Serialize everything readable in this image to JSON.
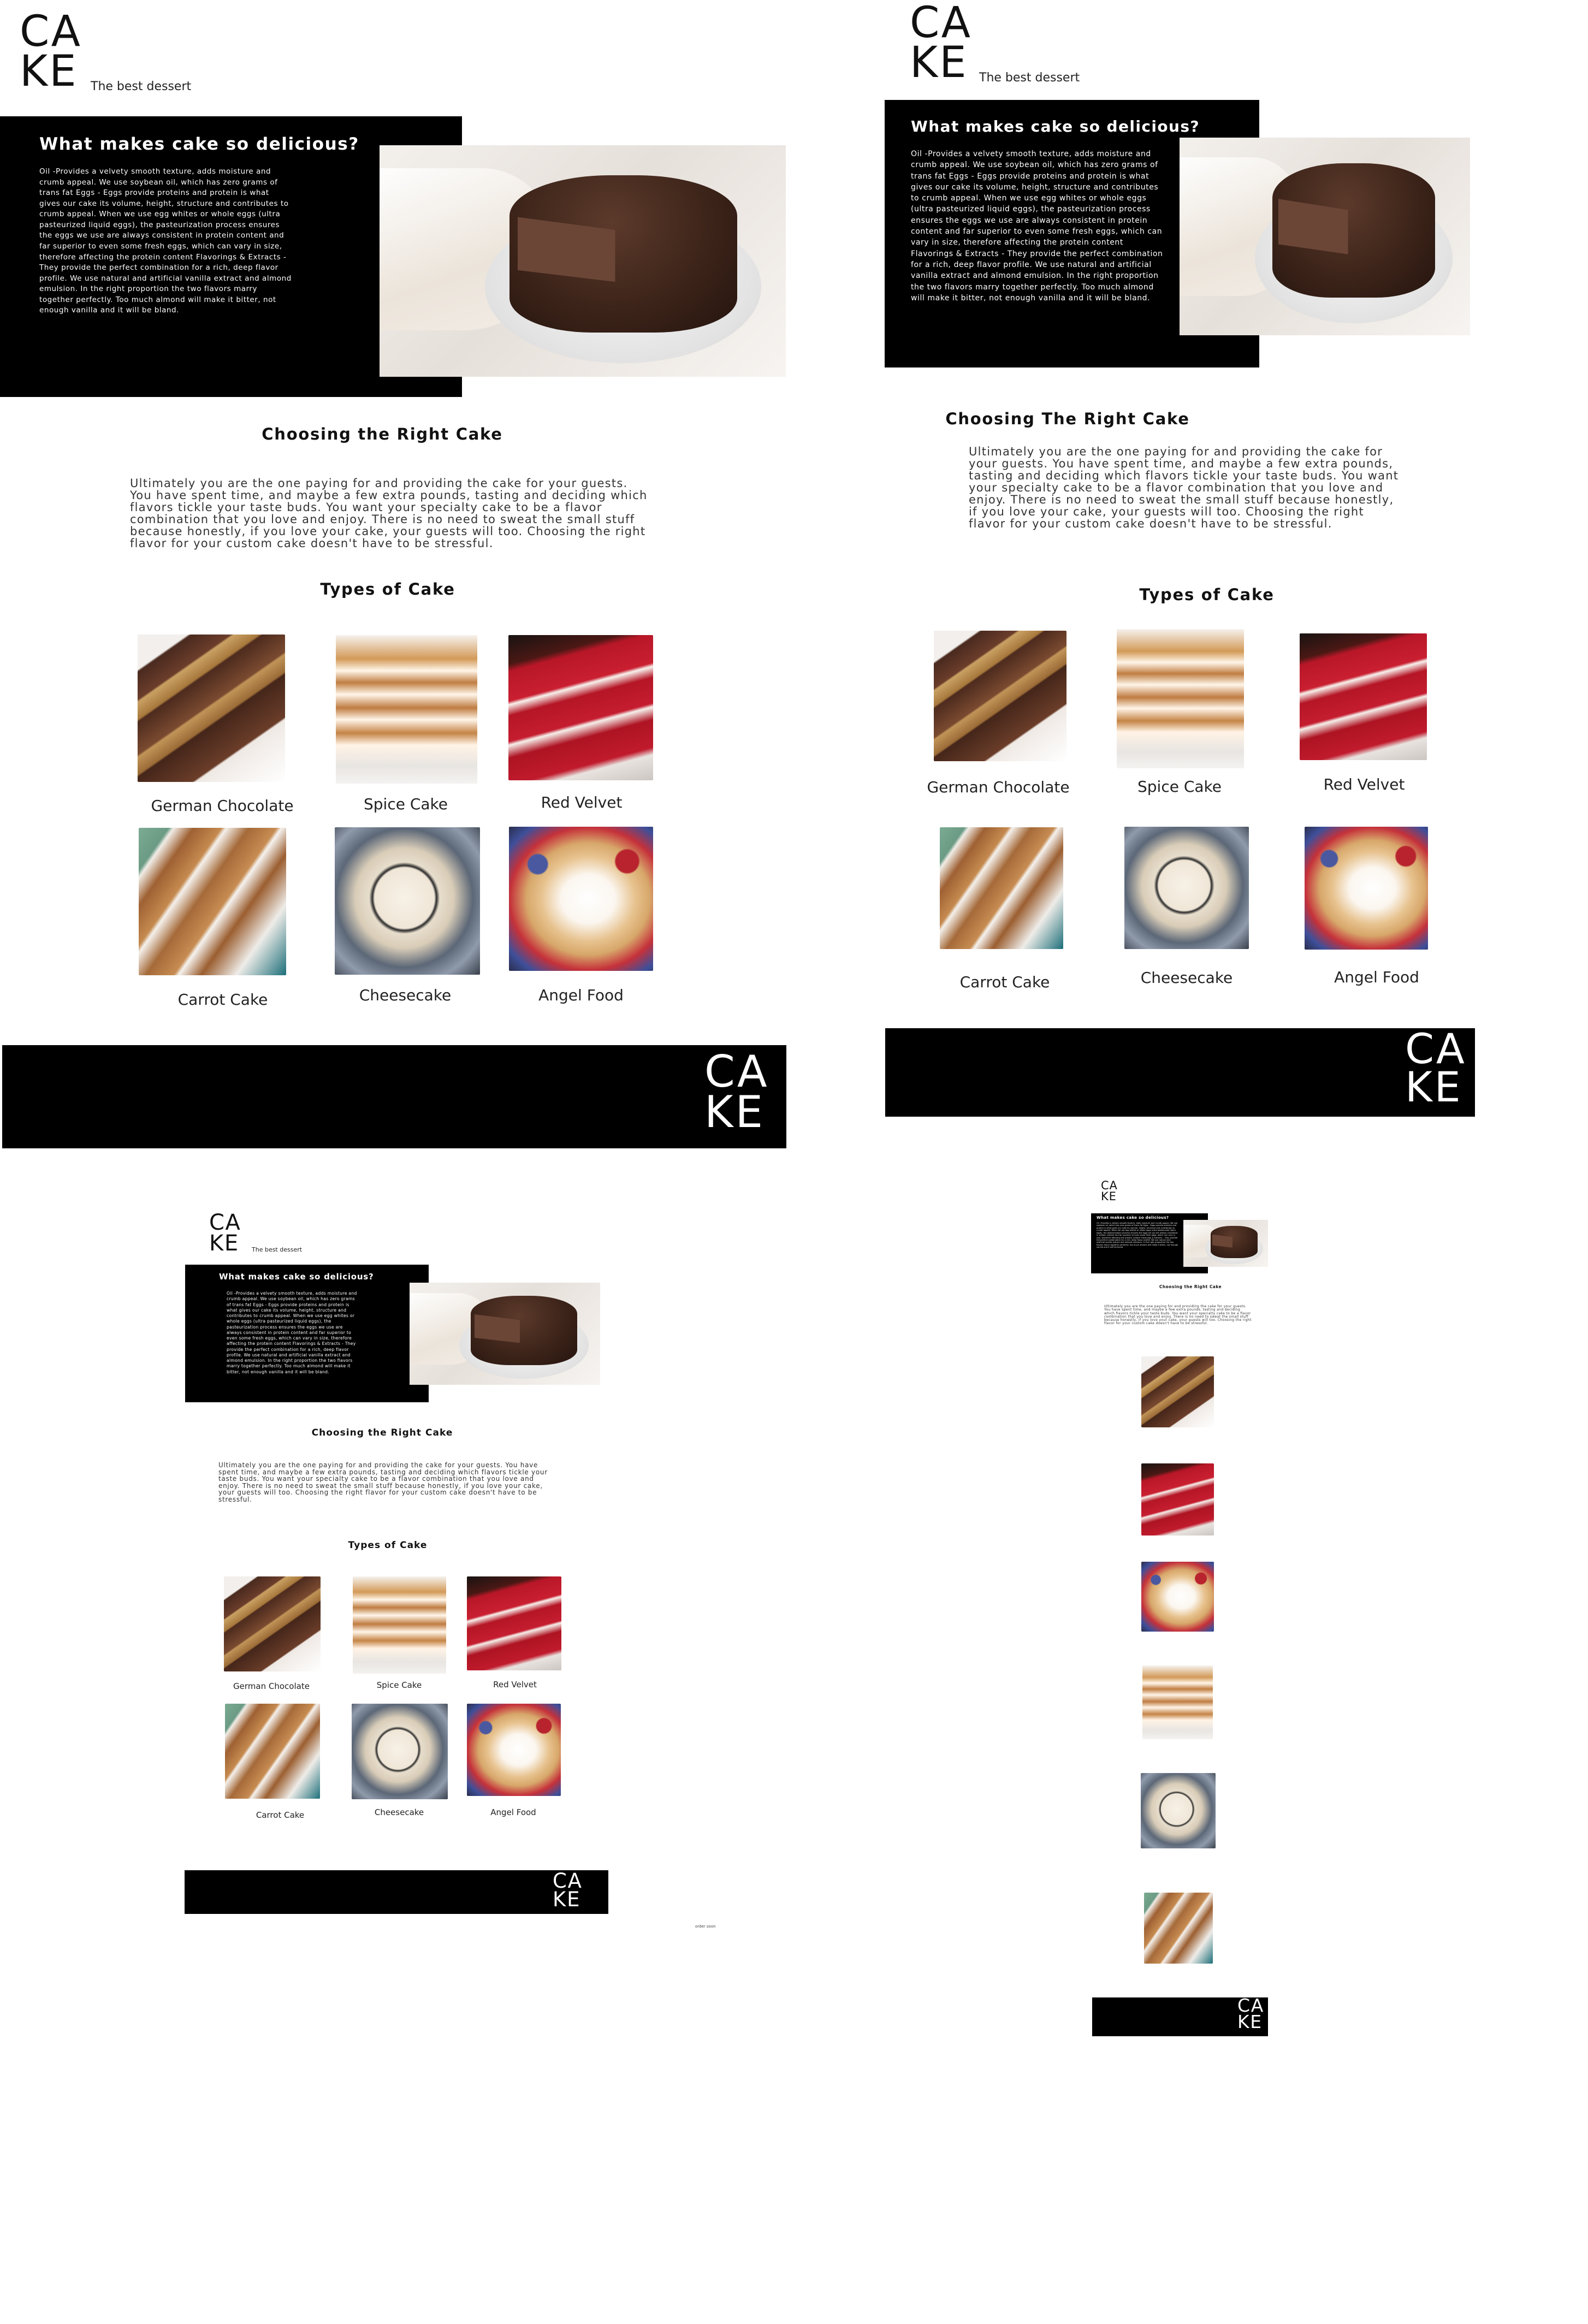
{
  "site": {
    "logo_top": "CA",
    "logo_bottom": "KE",
    "tagline": "The best dessert"
  },
  "hero": {
    "title": "What makes cake so delicious?",
    "body": "Oil -Provides a velvety smooth texture, adds moisture and crumb appeal. We use soybean oil, which has zero grams of trans fat Eggs - Eggs provide proteins and protein is what gives our cake its volume, height, structure and contributes to crumb appeal. When we use egg whites or whole eggs (ultra pasteurized liquid eggs), the pasteurization process ensures the eggs we use are always consistent in protein content and far superior to even some fresh eggs, which can vary in size, therefore affecting the protein content Flavorings & Extracts - They provide the perfect combination for a rich, deep flavor profile. We use natural and artificial vanilla extract and almond emulsion. In the right proportion the two flavors marry together perfectly. Too much almond will make it bitter, not enough vanilla and it will be bland."
  },
  "choosing": {
    "title": "Choosing the Right Cake",
    "title_alt": "Choosing The Right Cake",
    "body": "Ultimately you are the one paying for and providing the cake for your guests. You have spent time, and maybe a few extra pounds, tasting and deciding which flavors tickle your taste buds. You want your specialty cake to be a flavor combination that you love and enjoy. There is no need to sweat the small stuff because honestly, if you love your cake, your guests will too. Choosing the right flavor for your custom cake doesn't have to be stressful."
  },
  "types": {
    "title": "Types of Cake",
    "items": [
      {
        "label": "German Chocolate",
        "image": "german-chocolate-cake-photo"
      },
      {
        "label": "Spice Cake",
        "image": "spice-cake-photo"
      },
      {
        "label": "Red Velvet",
        "image": "red-velvet-cake-photo"
      },
      {
        "label": "Carrot Cake",
        "image": "carrot-cake-photo"
      },
      {
        "label": "Cheesecake",
        "image": "cheesecake-photo"
      },
      {
        "label": "Angel Food",
        "image": "angel-food-cake-photo"
      }
    ]
  },
  "footer": {
    "logo_top": "CA",
    "logo_bottom": "KE"
  },
  "misc": {
    "note_small": "order soon"
  }
}
